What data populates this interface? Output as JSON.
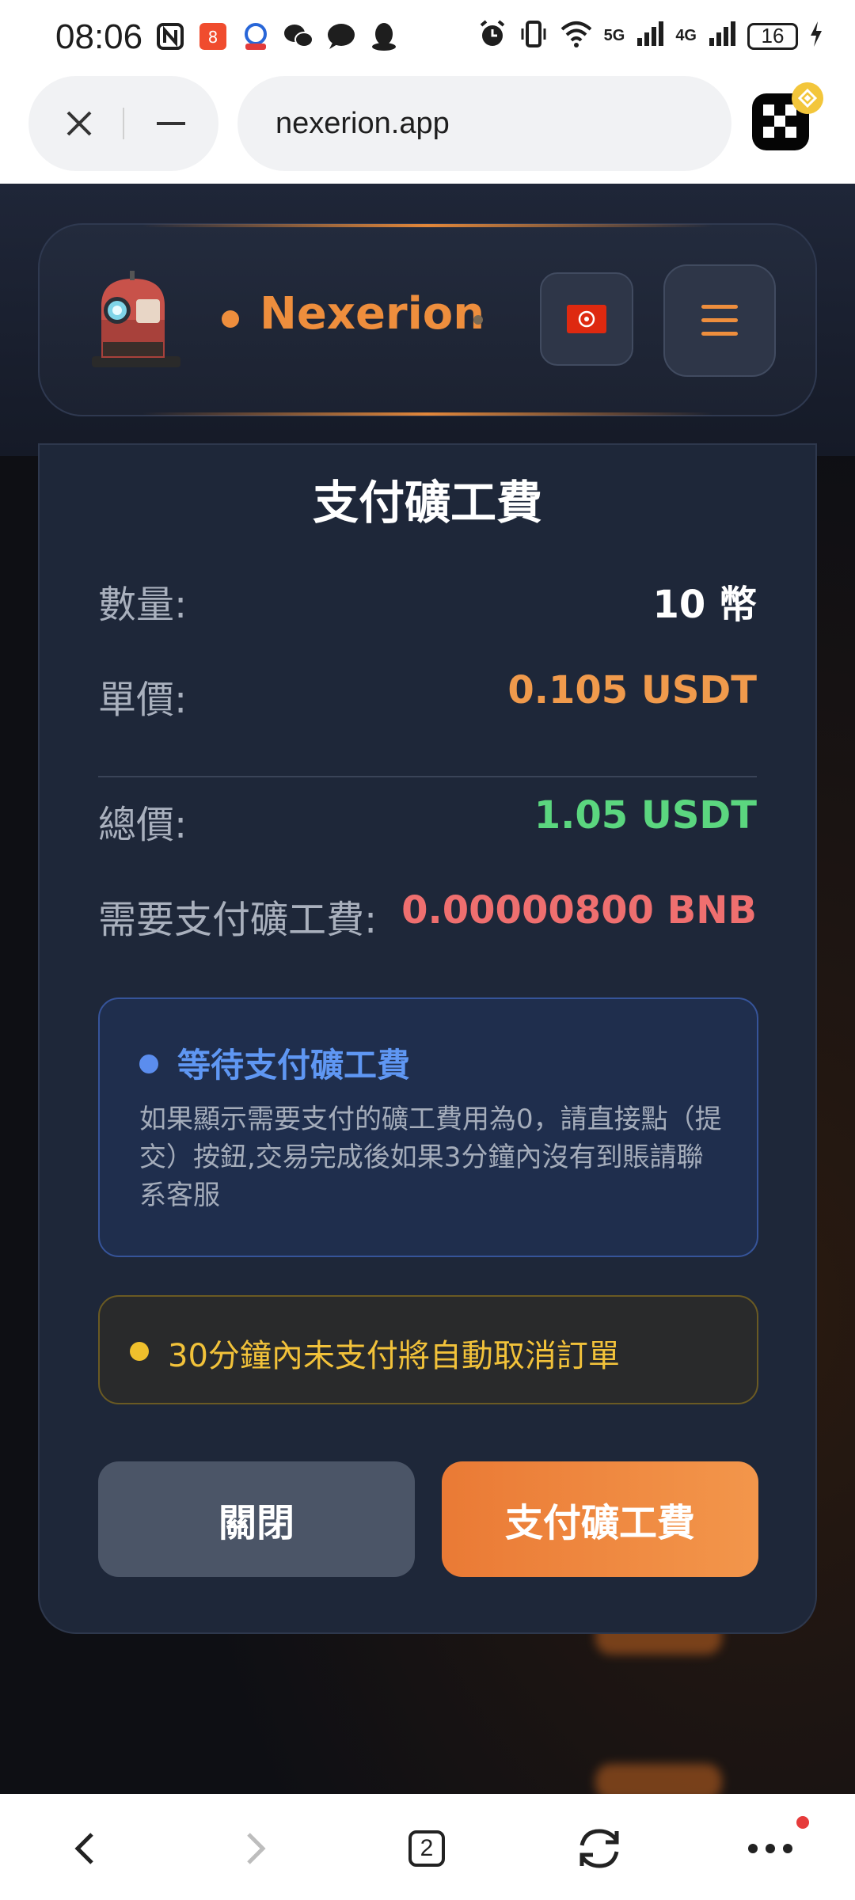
{
  "status_bar": {
    "time": "08:06",
    "network_1": "5G",
    "network_2": "4G",
    "battery": "16",
    "notifications": [
      "nfc-icon",
      "app-icon",
      "app-icon-2",
      "wechat-icon",
      "message-icon",
      "qq-icon"
    ]
  },
  "browser": {
    "url": "nexerion.app"
  },
  "header": {
    "brand": "Nexerion",
    "language_flag": "hong-kong-flag-icon"
  },
  "modal": {
    "title": "支付礦工費",
    "rows": [
      {
        "label": "數量:",
        "value": "10 幣"
      },
      {
        "label": "單價:",
        "value": "0.105 USDT"
      },
      {
        "label": "總價:",
        "value": "1.05 USDT"
      },
      {
        "label": "需要支付礦工費:",
        "value": "0.00000800 BNB"
      }
    ],
    "info_title": "等待支付礦工費",
    "info_text": "如果顯示需要支付的礦工費用為0，請直接點（提交）按鈕,交易完成後如果3分鐘內沒有到賬請聯系客服",
    "warning": "30分鐘內未支付將自動取消訂單",
    "close_label": "關閉",
    "pay_label": "支付礦工費"
  },
  "bottom_nav": {
    "tab_count": "2"
  },
  "colors": {
    "accent_orange": "#ee8e3d",
    "price_orange": "#f09a4c",
    "total_green": "#5bd67f",
    "fee_red": "#ef6f6f",
    "info_blue": "#5f97f3",
    "warning_yellow": "#f2c23a"
  }
}
